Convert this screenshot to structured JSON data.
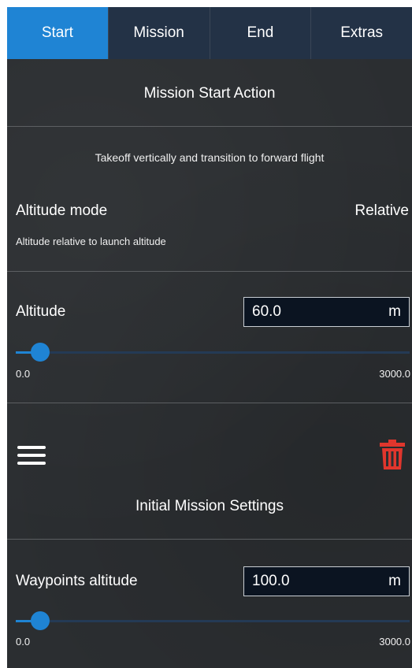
{
  "tabs": [
    {
      "label": "Start",
      "active": true
    },
    {
      "label": "Mission",
      "active": false
    },
    {
      "label": "End",
      "active": false
    },
    {
      "label": "Extras",
      "active": false
    }
  ],
  "start_action": {
    "title": "Mission Start Action",
    "description": "Takeoff vertically and transition to forward flight"
  },
  "altitude_mode": {
    "label": "Altitude mode",
    "value": "Relative",
    "hint": "Altitude relative to launch altitude"
  },
  "altitude": {
    "label": "Altitude",
    "value": "60.0",
    "unit": "m",
    "slider_min": "0.0",
    "slider_max": "3000.0",
    "slider_value": 60.0
  },
  "toolbar": {
    "menu_icon": "hamburger-menu-icon",
    "delete_icon": "trash-icon"
  },
  "initial_settings": {
    "title": "Initial Mission Settings"
  },
  "waypoints_altitude": {
    "label": "Waypoints altitude",
    "value": "100.0",
    "unit": "m",
    "slider_min": "0.0",
    "slider_max": "3000.0",
    "slider_value": 100.0
  },
  "colors": {
    "accent": "#1f84d4",
    "danger": "#e0362d",
    "background": "#2b2e31",
    "tab_inactive": "#233246"
  }
}
